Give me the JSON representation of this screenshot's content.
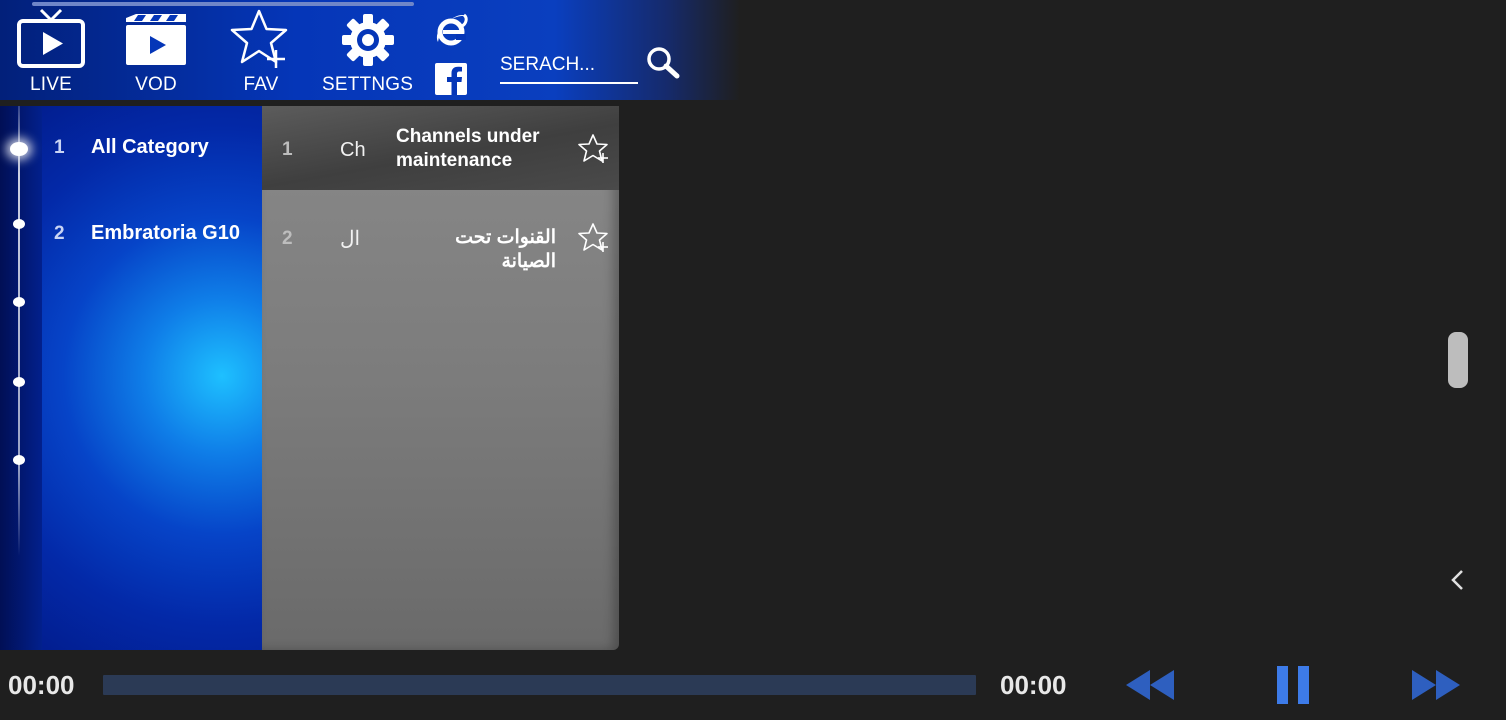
{
  "nav": {
    "items": [
      {
        "label": "LIVE",
        "icon": "live-tv-icon"
      },
      {
        "label": "VOD",
        "icon": "clapperboard-icon"
      },
      {
        "label": "FAV",
        "icon": "star-plus-icon"
      },
      {
        "label": "SETTNGS",
        "icon": "gear-icon"
      }
    ],
    "browser_icon": "internet-explorer-icon",
    "facebook_icon": "facebook-icon"
  },
  "search": {
    "placeholder": "SERACH...",
    "value": "",
    "icon": "search-icon"
  },
  "categories": [
    {
      "num": "1",
      "name": "All Category",
      "active": true
    },
    {
      "num": "2",
      "name": "Embratoria G10",
      "active": false
    }
  ],
  "channels": [
    {
      "num": "1",
      "abbr": "Ch",
      "name": "Channels under maintenance",
      "selected": true
    },
    {
      "num": "2",
      "abbr": "ال",
      "name": "القنوات تحت الصيانة",
      "selected": false
    }
  ],
  "player": {
    "current_time": "00:00",
    "total_time": "00:00",
    "progress": 0
  },
  "colors": {
    "accent": "#3d7be8",
    "topbar": "#0536b8",
    "background": "#1f1f1f"
  }
}
